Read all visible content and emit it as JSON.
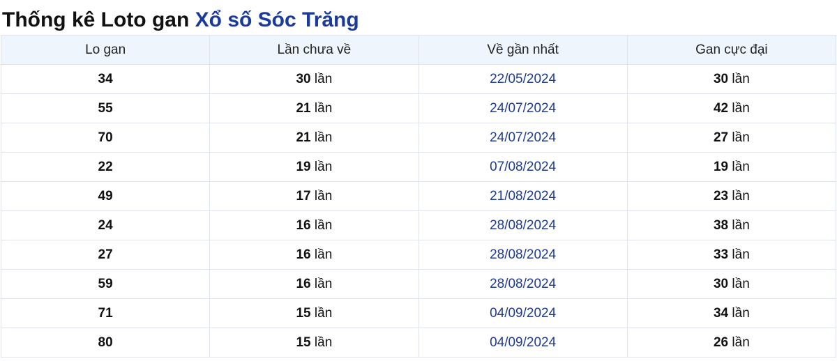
{
  "title": {
    "prefix": "Thống kê Loto gan",
    "link": "Xổ số Sóc Trăng"
  },
  "table": {
    "headers": [
      "Lo gan",
      "Lần chưa về",
      "Về gần nhất",
      "Gan cực đại"
    ],
    "unit": "lần",
    "rows": [
      {
        "lo": "34",
        "chua_ve": "30",
        "gan_nhat": "22/05/2024",
        "cuc_dai": "30"
      },
      {
        "lo": "55",
        "chua_ve": "21",
        "gan_nhat": "24/07/2024",
        "cuc_dai": "42"
      },
      {
        "lo": "70",
        "chua_ve": "21",
        "gan_nhat": "24/07/2024",
        "cuc_dai": "27"
      },
      {
        "lo": "22",
        "chua_ve": "19",
        "gan_nhat": "07/08/2024",
        "cuc_dai": "19"
      },
      {
        "lo": "49",
        "chua_ve": "17",
        "gan_nhat": "21/08/2024",
        "cuc_dai": "23"
      },
      {
        "lo": "24",
        "chua_ve": "16",
        "gan_nhat": "28/08/2024",
        "cuc_dai": "38"
      },
      {
        "lo": "27",
        "chua_ve": "16",
        "gan_nhat": "28/08/2024",
        "cuc_dai": "33"
      },
      {
        "lo": "59",
        "chua_ve": "16",
        "gan_nhat": "28/08/2024",
        "cuc_dai": "30"
      },
      {
        "lo": "71",
        "chua_ve": "15",
        "gan_nhat": "04/09/2024",
        "cuc_dai": "34"
      },
      {
        "lo": "80",
        "chua_ve": "15",
        "gan_nhat": "04/09/2024",
        "cuc_dai": "26"
      }
    ]
  },
  "colors": {
    "title_link": "#1a3a9c",
    "date_text": "#1e3b8f",
    "header_bg": "#eef5fc",
    "border": "#e0e4ea"
  }
}
